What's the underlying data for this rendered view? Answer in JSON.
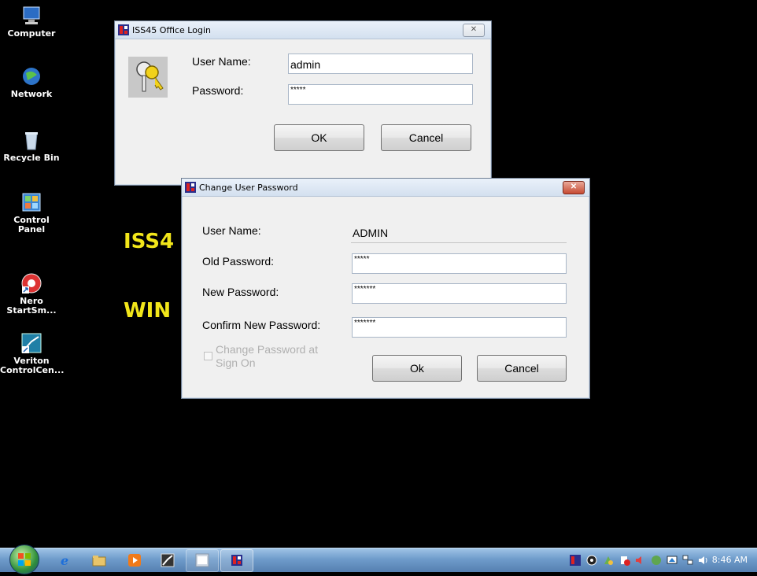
{
  "desktop": {
    "icons": [
      {
        "label": "Computer"
      },
      {
        "label": "Network"
      },
      {
        "label": "Recycle Bin"
      },
      {
        "label": "Control Panel"
      },
      {
        "label": "Nero\nStartSm..."
      },
      {
        "label": "Veriton\nControlCen..."
      }
    ],
    "bg_text_1": "ISS4",
    "bg_text_2": "WIN"
  },
  "login_window": {
    "title": "ISS45 Office Login",
    "username_label": "User Name:",
    "username_value": "admin",
    "password_label": "Password:",
    "password_value": "*****",
    "ok_label": "OK",
    "cancel_label": "Cancel",
    "close_glyph": "✕"
  },
  "change_password_window": {
    "title": "Change User Password",
    "username_label": "User Name:",
    "username_value": "ADMIN",
    "old_password_label": "Old Password:",
    "old_password_value": "*****",
    "new_password_label": "New Password:",
    "new_password_value": "*******",
    "confirm_password_label": "Confirm New Password:",
    "confirm_password_value": "*******",
    "change_on_signon_label_1": "Change Password at",
    "change_on_signon_label_2": "Sign On",
    "ok_label": "Ok",
    "cancel_label": "Cancel",
    "close_glyph": "✕"
  },
  "taskbar": {
    "clock": "8:46 AM"
  },
  "colors": {
    "desktop_bg": "#000000",
    "bg_text": "#f2e61a",
    "taskbar": "#6f9ccb"
  }
}
